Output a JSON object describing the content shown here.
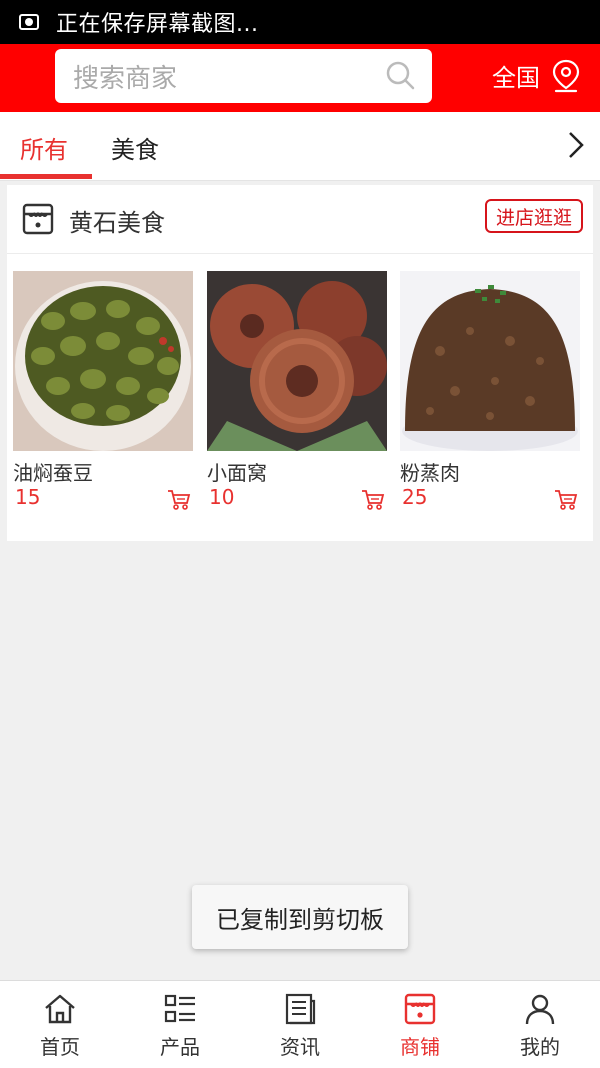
{
  "status_bar": {
    "text": "正在保存屏幕截图..."
  },
  "header": {
    "search_placeholder": "搜索商家",
    "region_label": "全国"
  },
  "tabs": [
    {
      "label": "所有",
      "active": true
    },
    {
      "label": "美食",
      "active": false
    }
  ],
  "shop": {
    "name": "黄石美食",
    "enter_label": "进店逛逛",
    "products": [
      {
        "name": "油焖蚕豆",
        "price": "15"
      },
      {
        "name": "小面窝",
        "price": "10"
      },
      {
        "name": "粉蒸肉",
        "price": "25"
      }
    ]
  },
  "toast": {
    "text": "已复制到剪切板"
  },
  "tabbar": [
    {
      "label": "首页",
      "icon": "home-icon"
    },
    {
      "label": "产品",
      "icon": "list-icon"
    },
    {
      "label": "资讯",
      "icon": "news-icon"
    },
    {
      "label": "商铺",
      "icon": "store-icon",
      "active": true
    },
    {
      "label": "我的",
      "icon": "user-icon"
    }
  ],
  "colors": {
    "brand_red": "#ff0000",
    "accent_red": "#e8312f"
  }
}
